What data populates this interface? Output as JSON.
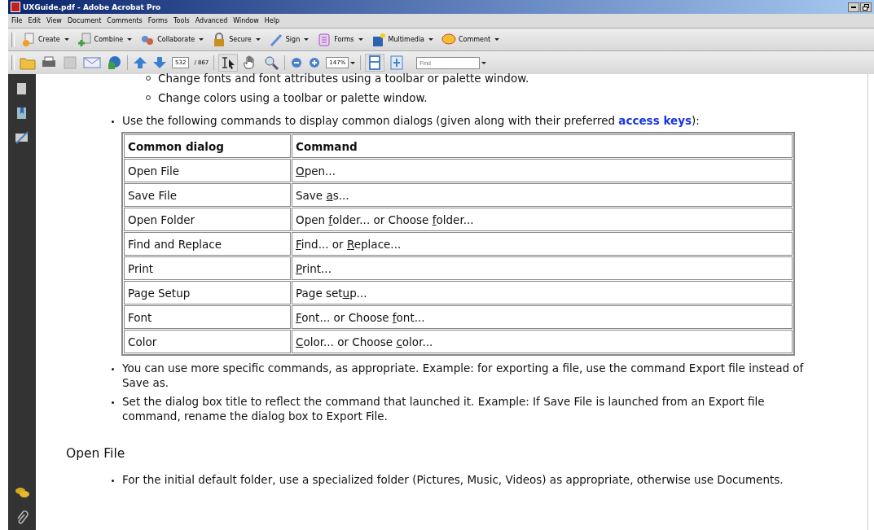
{
  "window": {
    "title": "UXGuide.pdf - Adobe Acrobat Pro"
  },
  "menu": [
    "File",
    "Edit",
    "View",
    "Document",
    "Comments",
    "Forms",
    "Tools",
    "Advanced",
    "Window",
    "Help"
  ],
  "task_toolbar": [
    "Create",
    "Combine",
    "Collaborate",
    "Secure",
    "Sign",
    "Forms",
    "Multimedia",
    "Comment"
  ],
  "nav_toolbar": {
    "page_number": "532",
    "page_total": "/ 867",
    "zoom": "147%",
    "find_placeholder": "Find"
  },
  "document": {
    "sub_items": [
      "Change fonts and font attributes using a toolbar or palette window.",
      "Change colors using a toolbar or palette window."
    ],
    "intro": {
      "text": "Use the following commands to display common dialogs (given along with their preferred ",
      "link": "access keys",
      "after": "):"
    },
    "table": {
      "columns": [
        "Common dialog",
        "Command"
      ],
      "rows": [
        {
          "dialog": "Open File",
          "command": [
            {
              "text": "O",
              "underlined": true
            },
            {
              "text": "pen...",
              "underlined": false
            }
          ]
        },
        {
          "dialog": "Save File",
          "command": [
            {
              "text": "Save ",
              "underlined": false
            },
            {
              "text": "a",
              "underlined": true
            },
            {
              "text": "s...",
              "underlined": false
            }
          ]
        },
        {
          "dialog": "Open Folder",
          "command": [
            {
              "text": "Open ",
              "underlined": false
            },
            {
              "text": "f",
              "underlined": true
            },
            {
              "text": "older... or Choose ",
              "underlined": false
            },
            {
              "text": "f",
              "underlined": true
            },
            {
              "text": "older...",
              "underlined": false
            }
          ]
        },
        {
          "dialog": "Find and Replace",
          "command": [
            {
              "text": "F",
              "underlined": true
            },
            {
              "text": "ind... or ",
              "underlined": false
            },
            {
              "text": "R",
              "underlined": true
            },
            {
              "text": "eplace...",
              "underlined": false
            }
          ]
        },
        {
          "dialog": "Print",
          "command": [
            {
              "text": "P",
              "underlined": true
            },
            {
              "text": "rint...",
              "underlined": false
            }
          ]
        },
        {
          "dialog": "Page Setup",
          "command": [
            {
              "text": "Page set",
              "underlined": false
            },
            {
              "text": "u",
              "underlined": true
            },
            {
              "text": "p...",
              "underlined": false
            }
          ]
        },
        {
          "dialog": "Font",
          "command": [
            {
              "text": "F",
              "underlined": true
            },
            {
              "text": "ont... or Choose ",
              "underlined": false
            },
            {
              "text": "f",
              "underlined": true
            },
            {
              "text": "ont...",
              "underlined": false
            }
          ]
        },
        {
          "dialog": "Color",
          "command": [
            {
              "text": "C",
              "underlined": true
            },
            {
              "text": "olor... or Choose ",
              "underlined": false
            },
            {
              "text": "c",
              "underlined": true
            },
            {
              "text": "olor...",
              "underlined": false
            }
          ]
        }
      ]
    },
    "bullets": [
      "You can use more specific commands, as appropriate. Example: for exporting a file, use the command Export file instead of Save as.",
      "Set the dialog box title to reflect the command that launched it. Example: If Save File is launched from an Export file command, rename the dialog box to Export File."
    ],
    "heading": "Open File",
    "bullets_2": [
      "For the initial default folder, use a specialized folder (Pictures, Music, Videos) as appropriate, otherwise use Documents."
    ]
  }
}
